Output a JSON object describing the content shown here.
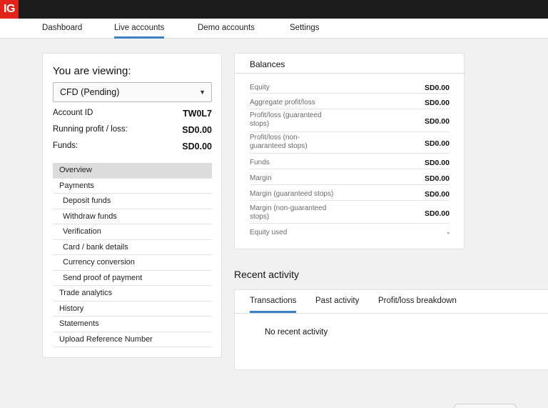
{
  "app": {
    "logo_text": "IG",
    "brand_color": "#e2231a",
    "accent_color": "#3b82c4"
  },
  "nav": {
    "tabs": [
      {
        "label": "Dashboard",
        "active": false
      },
      {
        "label": "Live accounts",
        "active": true
      },
      {
        "label": "Demo accounts",
        "active": false
      },
      {
        "label": "Settings",
        "active": false
      }
    ]
  },
  "account": {
    "viewing_title": "You are viewing:",
    "selected_account": "CFD (Pending)",
    "details": [
      {
        "label": "Account ID",
        "value": "TW0L7"
      },
      {
        "label": "Running profit / loss:",
        "value": "SD0.00"
      },
      {
        "label": "Funds:",
        "value": "SD0.00"
      }
    ],
    "menu": [
      {
        "label": "Overview",
        "active": true,
        "sub": false
      },
      {
        "label": "Payments",
        "active": false,
        "sub": false
      },
      {
        "label": "Deposit funds",
        "active": false,
        "sub": true
      },
      {
        "label": "Withdraw funds",
        "active": false,
        "sub": true
      },
      {
        "label": "Verification",
        "active": false,
        "sub": true
      },
      {
        "label": "Card / bank details",
        "active": false,
        "sub": true
      },
      {
        "label": "Currency conversion",
        "active": false,
        "sub": true
      },
      {
        "label": "Send proof of payment",
        "active": false,
        "sub": true
      },
      {
        "label": "Trade analytics",
        "active": false,
        "sub": false
      },
      {
        "label": "History",
        "active": false,
        "sub": false
      },
      {
        "label": "Statements",
        "active": false,
        "sub": false
      },
      {
        "label": "Upload Reference Number",
        "active": false,
        "sub": false
      }
    ]
  },
  "balances": {
    "title": "Balances",
    "rows": [
      {
        "label": "Equity",
        "value": "SD0.00"
      },
      {
        "label": "Aggregate profit/loss",
        "value": "SD0.00"
      },
      {
        "label": "Profit/loss (guaranteed stops)",
        "value": "SD0.00"
      },
      {
        "label": "Profit/loss (non-guaranteed stops)",
        "value": "SD0.00"
      },
      {
        "label": "Funds",
        "value": "SD0.00"
      },
      {
        "label": "Margin",
        "value": "SD0.00"
      },
      {
        "label": "Margin (guaranteed stops)",
        "value": "SD0.00"
      },
      {
        "label": "Margin (non-guaranteed stops)",
        "value": "SD0.00"
      },
      {
        "label": "Equity used",
        "value": "-"
      }
    ]
  },
  "recent_activity": {
    "title": "Recent activity",
    "tabs": [
      {
        "label": "Transactions",
        "active": true
      },
      {
        "label": "Past activity",
        "active": false
      },
      {
        "label": "Profit/loss breakdown",
        "active": false
      }
    ],
    "empty_message": "No recent activity"
  }
}
